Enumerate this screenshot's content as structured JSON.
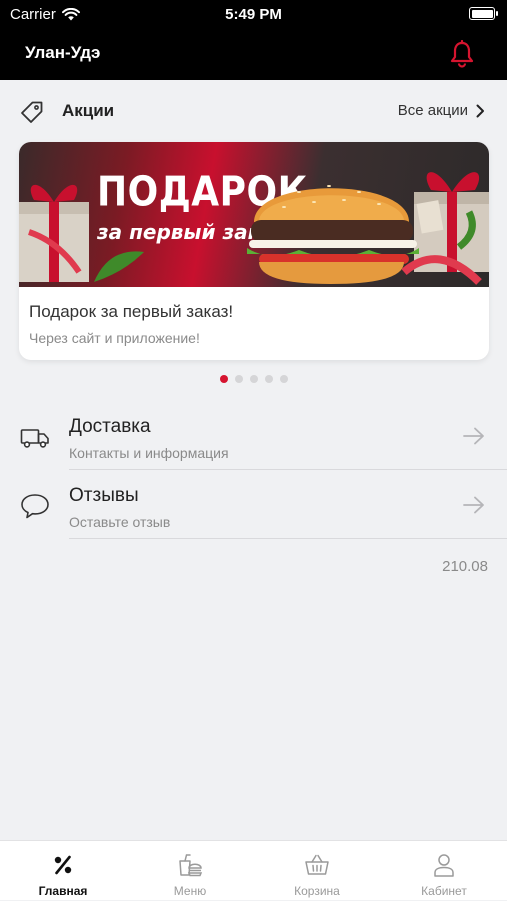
{
  "status_bar": {
    "carrier": "Carrier",
    "time": "5:49 PM"
  },
  "header": {
    "city": "Улан-Удэ"
  },
  "promotions": {
    "title": "Акции",
    "all_link": "Все акции",
    "banner": {
      "headline": "ПОДАРОК",
      "subline": "за первый заказ!"
    },
    "card_title": "Подарок за первый заказ!",
    "card_subtitle": "Через сайт и приложение!",
    "page_count": 5,
    "active_page": 1
  },
  "menu_rows": [
    {
      "title": "Доставка",
      "subtitle": "Контакты и информация"
    },
    {
      "title": "Отзывы",
      "subtitle": "Оставьте отзыв"
    }
  ],
  "version": "210.08",
  "tabs": [
    {
      "label": "Главная",
      "icon": "percent-icon",
      "active": true
    },
    {
      "label": "Меню",
      "icon": "food-icon",
      "active": false
    },
    {
      "label": "Корзина",
      "icon": "basket-icon",
      "active": false
    },
    {
      "label": "Кабинет",
      "icon": "user-icon",
      "active": false
    }
  ],
  "colors": {
    "accent": "#d6142f",
    "bar": "#000000",
    "background": "#f0f1f3"
  }
}
